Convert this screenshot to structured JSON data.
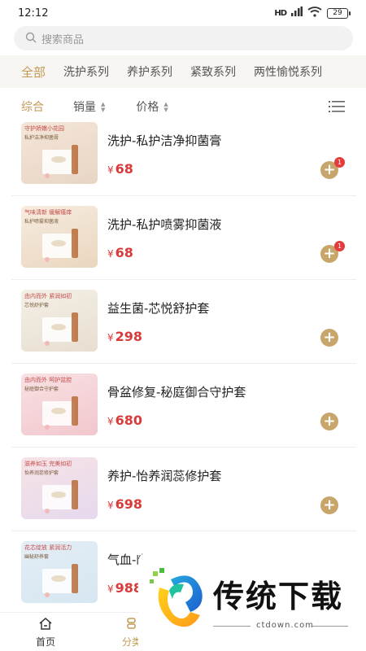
{
  "status_bar": {
    "time": "12:12",
    "signal": "HD",
    "battery": "29"
  },
  "search": {
    "placeholder": "搜索商品"
  },
  "categories": [
    "全部",
    "洗护系列",
    "养护系列",
    "紧致系列",
    "两性愉悦系列"
  ],
  "sort": {
    "comprehensive": "综合",
    "sales": "销量",
    "price": "价格"
  },
  "products": [
    {
      "name": "洗护-私护洁净抑菌膏",
      "price": "68",
      "currency": "¥",
      "badge": "1",
      "thumb_tag": "守护娇嫩小花园",
      "thumb_sub": "私护洁净抑菌膏",
      "thumb_colors": [
        "#f3e6d9",
        "#e8d5c4"
      ]
    },
    {
      "name": "洗护-私护喷雾抑菌液",
      "price": "68",
      "currency": "¥",
      "badge": "1",
      "thumb_tag": "气味清新 缓解瘙痒",
      "thumb_sub": "私护喷雾抑菌液",
      "thumb_colors": [
        "#f6ecdf",
        "#ead6bf"
      ]
    },
    {
      "name": "益生菌-芯悦舒护套",
      "price": "298",
      "currency": "¥",
      "badge": "",
      "thumb_tag": "由内而外 紧润如初",
      "thumb_sub": "芯悦舒护套",
      "thumb_colors": [
        "#f4efe6",
        "#e7ded0"
      ]
    },
    {
      "name": "骨盆修复-秘庭御合守护套",
      "price": "680",
      "currency": "¥",
      "badge": "",
      "thumb_tag": "由内而外 呵护盆腔",
      "thumb_sub": "秘庭御合守护套",
      "thumb_colors": [
        "#f8e1e3",
        "#f1c7cd"
      ]
    },
    {
      "name": "养护-怡养润蕊修护套",
      "price": "698",
      "currency": "¥",
      "badge": "",
      "thumb_tag": "滋养如玉 完美如初",
      "thumb_sub": "怡养润蕊修护套",
      "thumb_colors": [
        "#f6e3e6",
        "#e6d9ee"
      ]
    },
    {
      "name": "气血-幽秘舒养套",
      "price": "988",
      "currency": "¥",
      "badge": "",
      "thumb_tag": "花芯绽放 紧润活力",
      "thumb_sub": "幽秘舒养套",
      "thumb_colors": [
        "#e4eef6",
        "#d6e6f0"
      ]
    }
  ],
  "bottom_nav": {
    "home": "首页",
    "category": "分类"
  },
  "watermark": {
    "brand": "传统下载",
    "url": "ctdown.com"
  },
  "colors": {
    "accent": "#c29a56",
    "price": "#d93a3a",
    "badge": "#e43c3c"
  }
}
